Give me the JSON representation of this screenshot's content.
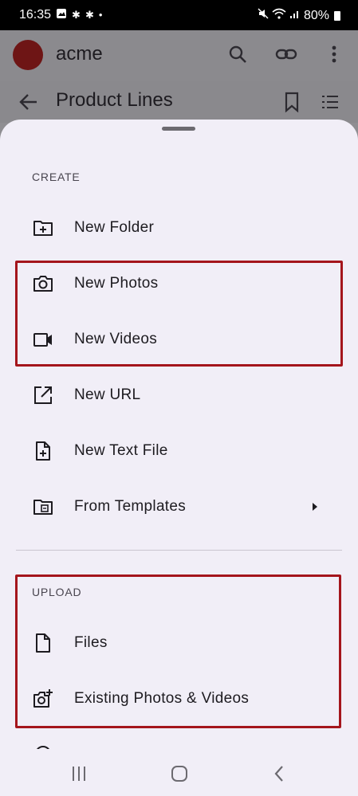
{
  "status_bar": {
    "time": "16:35",
    "battery": "80%",
    "left_icons": [
      "gallery-icon",
      "sparkle-icon",
      "sparkle-icon",
      "dot-icon"
    ],
    "right_icons": [
      "mute-icon",
      "wifi-icon",
      "signal-icon",
      "battery-icon"
    ]
  },
  "app_bar": {
    "title": "acme",
    "avatar_color": "#6e1515",
    "actions": [
      "search-icon",
      "link-icon",
      "more-vert-icon"
    ]
  },
  "toolbar": {
    "title": "Product Lines",
    "actions": [
      "bookmark-icon",
      "sort-list-icon"
    ]
  },
  "sheet": {
    "create_header": "CREATE",
    "create_items": [
      {
        "label": "New Folder",
        "icon": "folder-add-icon"
      },
      {
        "label": "New Photos",
        "icon": "camera-icon"
      },
      {
        "label": "New Videos",
        "icon": "videocam-icon"
      },
      {
        "label": "New URL",
        "icon": "open-in-new-icon"
      },
      {
        "label": "New Text File",
        "icon": "note-add-icon"
      },
      {
        "label": "From Templates",
        "icon": "folder-template-icon",
        "has_submenu": true
      }
    ],
    "upload_header": "UPLOAD",
    "upload_items": [
      {
        "label": "Files",
        "icon": "file-icon"
      },
      {
        "label": "Existing Photos & Videos",
        "icon": "add-photo-icon"
      }
    ]
  },
  "colors": {
    "sheet_bg": "#f1eef7",
    "highlight": "#a4151c",
    "text": "#1d1b20"
  },
  "nav_bar": [
    "recents-icon",
    "home-icon",
    "back-icon"
  ]
}
